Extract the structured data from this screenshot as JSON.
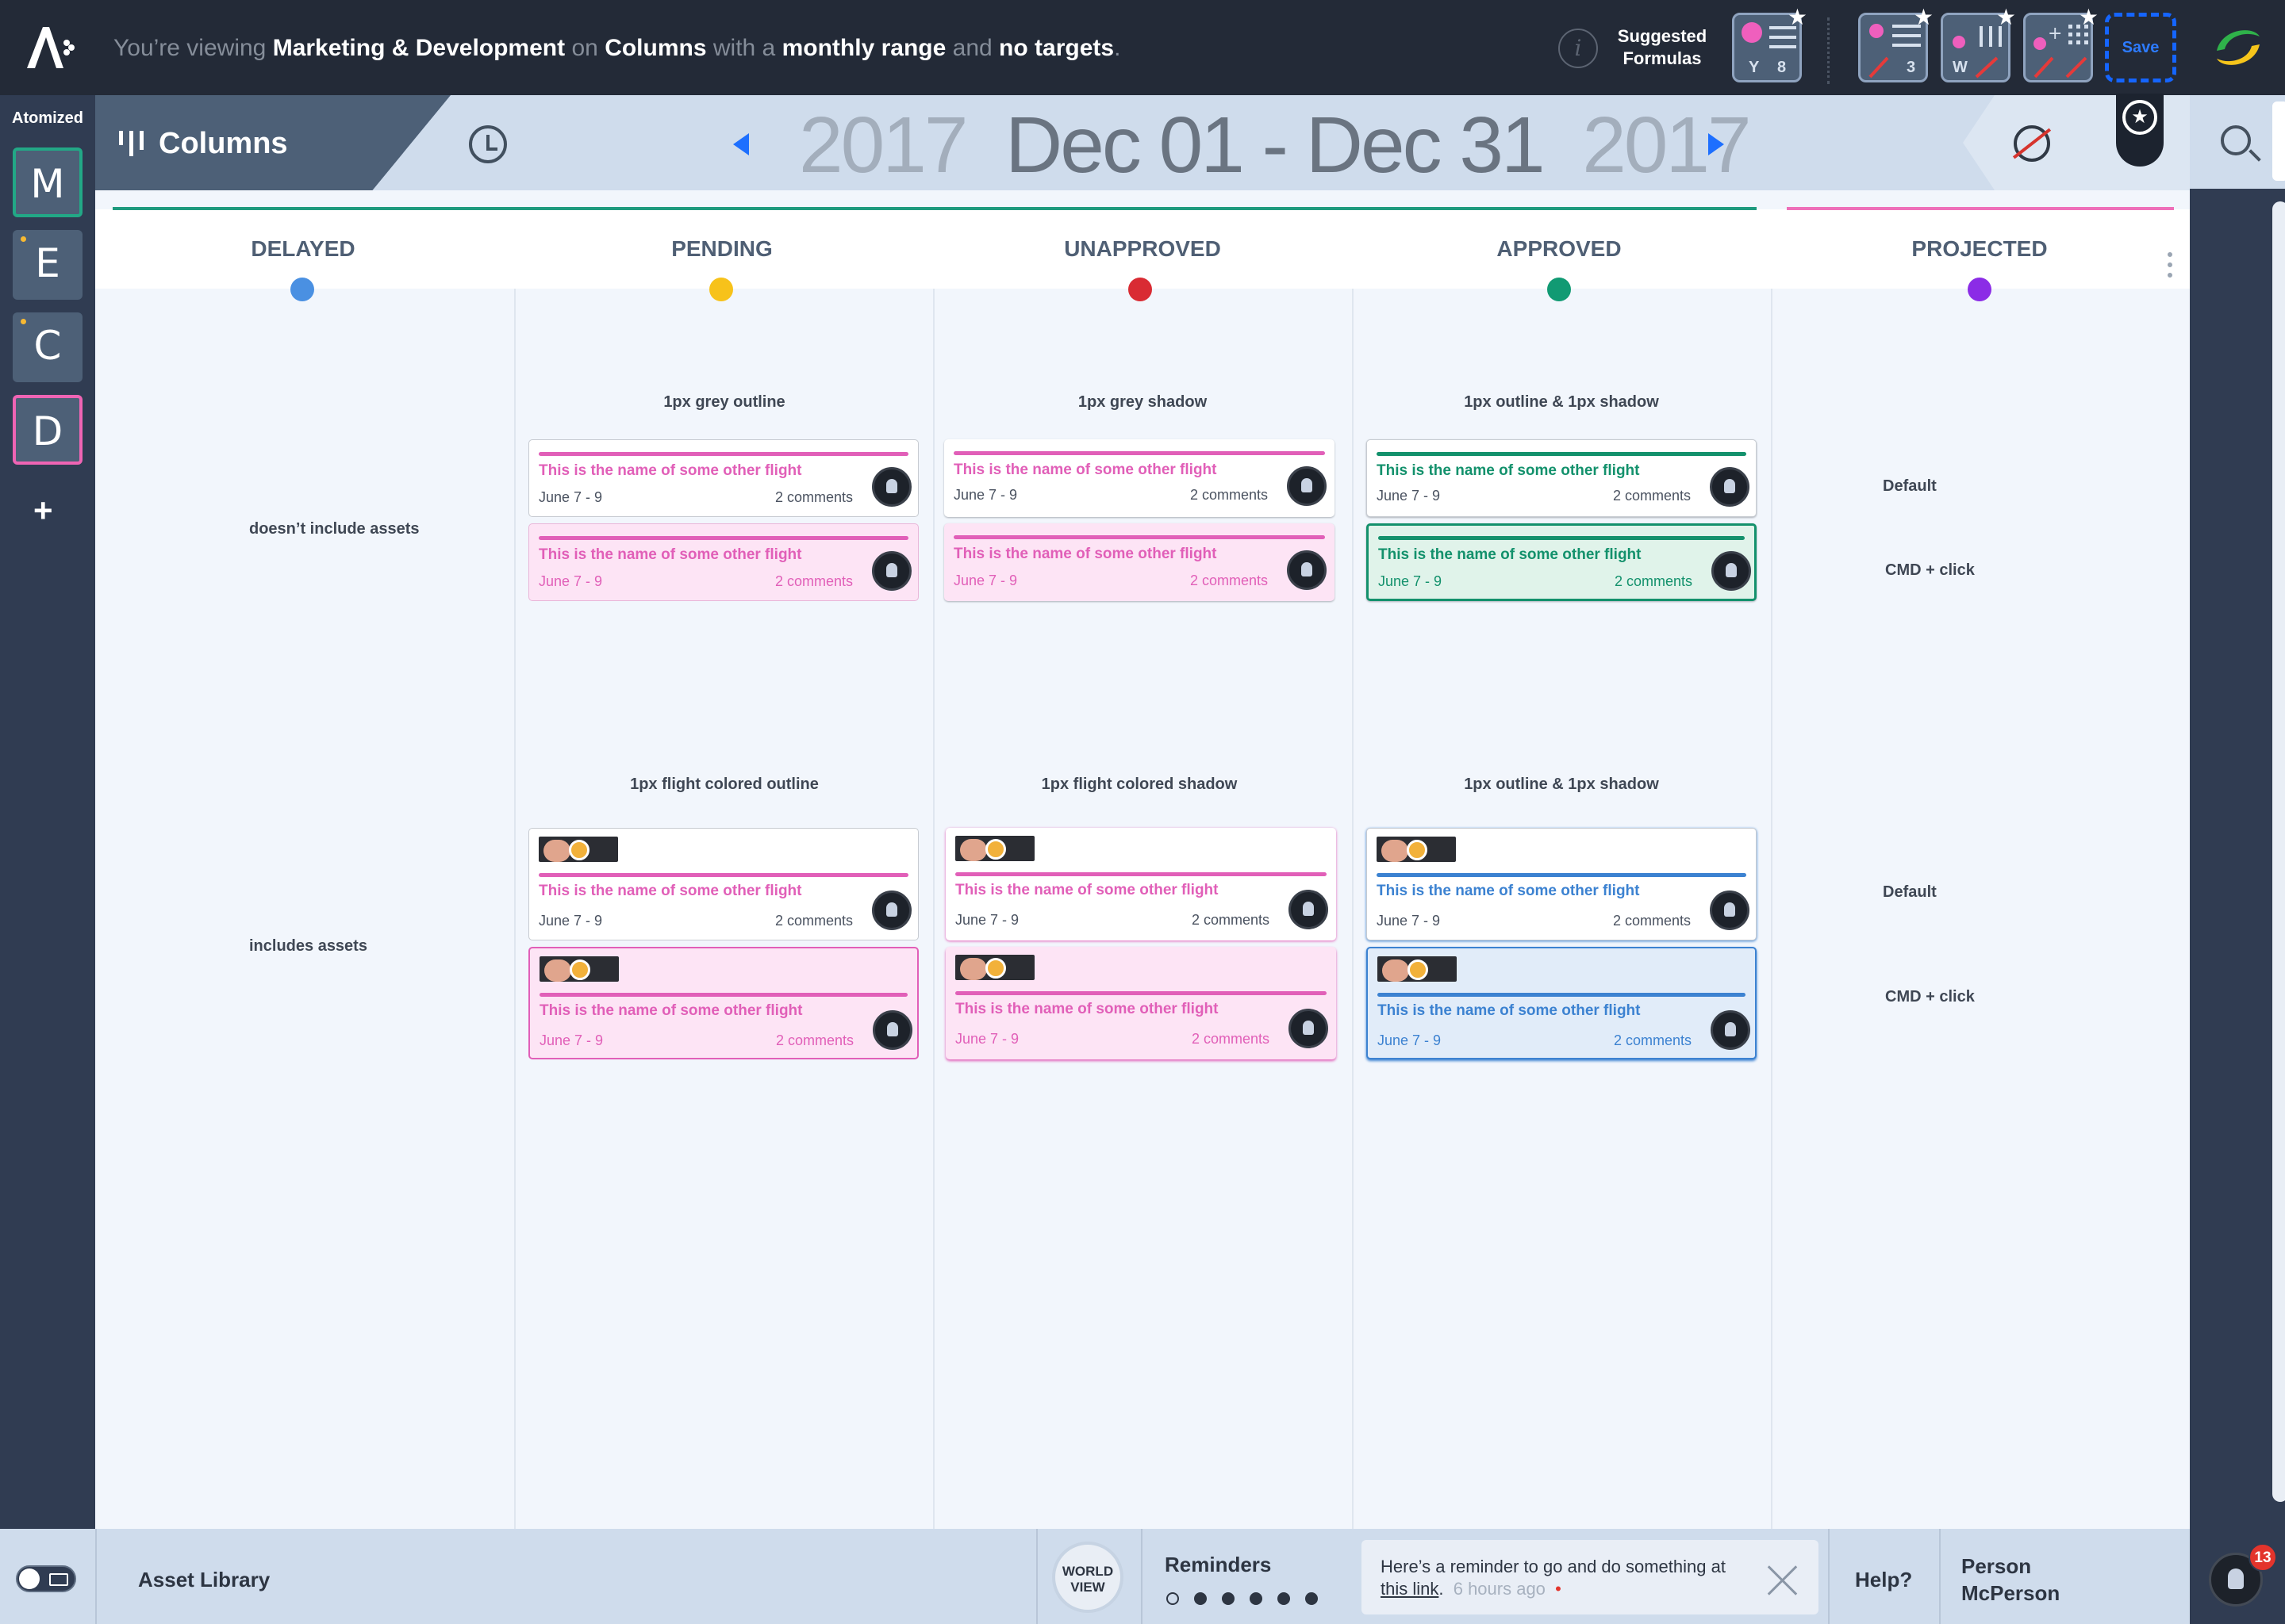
{
  "header": {
    "viewing_prefix": "You’re viewing",
    "workspace": "Marketing & Development",
    "on": "on",
    "view": "Columns",
    "with_a": "with a",
    "range": "monthly range",
    "and": "and",
    "targets": "no targets",
    "period": ".",
    "info_icon": "i",
    "suggested_line1": "Suggested",
    "suggested_line2": "Formulas",
    "formulas": [
      {
        "label": "Y",
        "count": "8"
      },
      {
        "label": "",
        "count": "3"
      },
      {
        "label": "W",
        "count": ""
      },
      {
        "label": "",
        "count": ""
      }
    ],
    "save_label": "Save"
  },
  "left_rail": {
    "title": "Atomized",
    "workspaces": [
      {
        "letter": "M",
        "border": "#22a886",
        "dot": false
      },
      {
        "letter": "E",
        "border": "none",
        "dot": true
      },
      {
        "letter": "C",
        "border": "none",
        "dot": true
      },
      {
        "letter": "D",
        "border": "#ef64b4",
        "dot": false
      }
    ],
    "add": "+"
  },
  "subheader": {
    "tab_label": "Columns",
    "year_start": "2017",
    "date_range": "Dec 01 - Dec 31",
    "year_end": "2017"
  },
  "columns": [
    {
      "name": "DELAYED",
      "color": "#4a90e2"
    },
    {
      "name": "PENDING",
      "color": "#f7c21a"
    },
    {
      "name": "UNAPPROVED",
      "color": "#d92b33"
    },
    {
      "name": "APPROVED",
      "color": "#119a73"
    },
    {
      "name": "PROJECTED",
      "color": "#8b2ce6"
    }
  ],
  "accent_colors": {
    "main": "#1f9a7e",
    "projected": "#ee6fb9"
  },
  "row_labels": {
    "no_assets": "doesn’t include assets",
    "with_assets": "includes assets"
  },
  "section_labels": {
    "pending_top": "1px grey outline",
    "unapproved_top": "1px grey shadow",
    "approved_top": "1px outline & 1px shadow",
    "pending_bottom": "1px flight colored outline",
    "unapproved_bottom": "1px flight colored shadow",
    "approved_bottom": "1px outline & 1px shadow"
  },
  "projected_labels": {
    "default_top": "Default",
    "cmd_top": "CMD + click",
    "default_bottom": "Default",
    "cmd_bottom": "CMD + click"
  },
  "card": {
    "name": "This is the name of some other flight",
    "dates": "June 7 - 9",
    "comments": "2 comments"
  },
  "card_colors": {
    "pink": "#e15fb8",
    "pink_bg": "#fde4f5",
    "green": "#13916c",
    "green_bg": "#e0f3ea",
    "blue": "#3c82d1",
    "blue_bg": "#e1ecf9"
  },
  "footer": {
    "asset_library": "Asset Library",
    "world_view_line1": "WORLD",
    "world_view_line2": "VIEW",
    "reminders_title": "Reminders",
    "reminder_text": "Here’s a reminder to go and do something at",
    "reminder_link": "this link",
    "reminder_after_link": ".",
    "reminder_time": "6 hours ago",
    "reminder_dot": "•",
    "help": "Help?",
    "person_first": "Person",
    "person_last": "McPerson",
    "notification_count": "13"
  }
}
